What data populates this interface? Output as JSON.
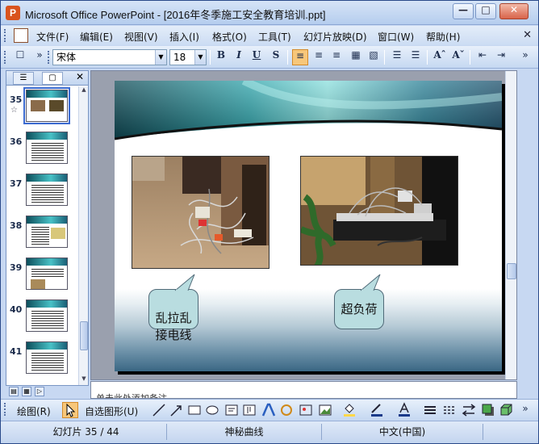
{
  "window": {
    "title": "Microsoft Office PowerPoint - [2016年冬季施工安全教育培训.ppt]",
    "buttons": [
      "minimize",
      "maximize",
      "close"
    ]
  },
  "menubar": {
    "items": [
      "文件(F)",
      "编辑(E)",
      "视图(V)",
      "插入(I)",
      "格式(O)",
      "工具(T)",
      "幻灯片放映(D)",
      "窗口(W)",
      "帮助(H)"
    ]
  },
  "formatting": {
    "font_name": "宋体",
    "font_size": "18",
    "bold": "B",
    "italic": "I",
    "underline": "U",
    "shadow": "S"
  },
  "slide_panel": {
    "tabs": [
      "outline",
      "slides"
    ],
    "selected_tab": "slides",
    "thumbnails": [
      {
        "num": "35",
        "marker": "☆",
        "selected": true
      },
      {
        "num": "36"
      },
      {
        "num": "37"
      },
      {
        "num": "38"
      },
      {
        "num": "39"
      },
      {
        "num": "40"
      },
      {
        "num": "41"
      }
    ]
  },
  "slide": {
    "callout_left": "乱拉乱\n接电线",
    "callout_right": "超负荷"
  },
  "notes": {
    "placeholder": "单击此处添加备注"
  },
  "drawing_toolbar": {
    "draw_menu": "绘图(R)",
    "autoshapes_menu": "自选图形(U)"
  },
  "status": {
    "slide_position": "幻灯片 35 / 44",
    "design": "神秘曲线",
    "language": "中文(中国)"
  },
  "colors": {
    "title_bar": "#c9daf3",
    "slide_teal": "#3fb3b8",
    "callout_fill": "#b9dde0",
    "active_button": "#f7c77a"
  }
}
